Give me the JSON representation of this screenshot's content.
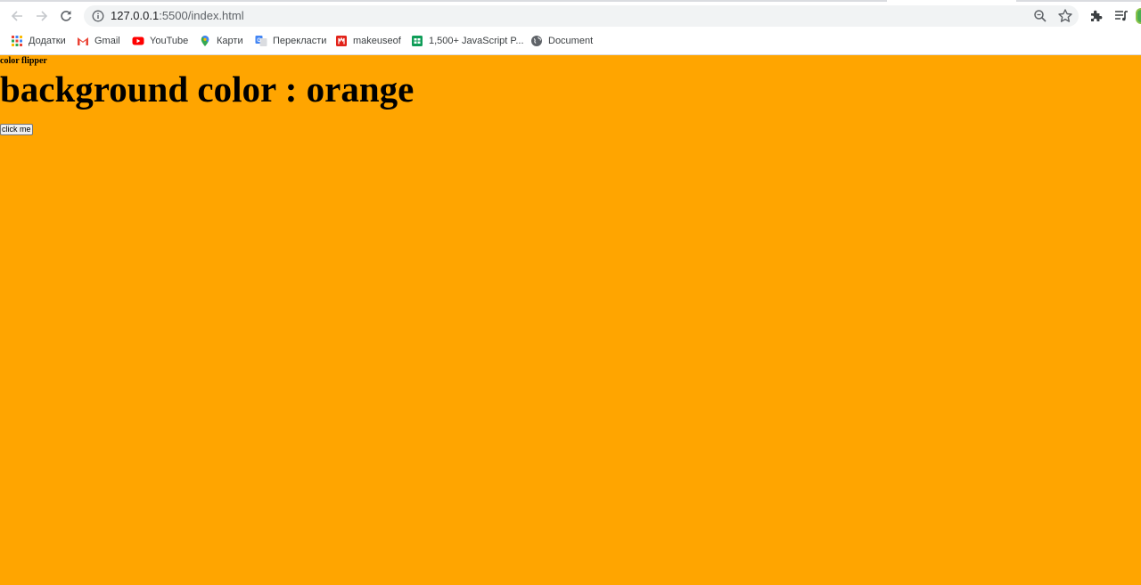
{
  "browser": {
    "url_host": "127.0.0.1",
    "url_rest": ":5500/index.html",
    "bookmarks": [
      {
        "label": "Додатки",
        "icon": "apps-grid-icon"
      },
      {
        "label": "Gmail",
        "icon": "gmail-icon"
      },
      {
        "label": "YouTube",
        "icon": "youtube-icon"
      },
      {
        "label": "Карти",
        "icon": "maps-pin-icon"
      },
      {
        "label": "Перекласти",
        "icon": "translate-icon"
      },
      {
        "label": "makeuseof",
        "icon": "makeuseof-icon"
      },
      {
        "label": "1,500+ JavaScript P...",
        "icon": "sheet-icon"
      },
      {
        "label": "Document",
        "icon": "globe-icon"
      }
    ]
  },
  "page": {
    "background_color": "#ffa500",
    "small_title": "color flipper",
    "heading": "background color : orange",
    "button_label": "click me"
  }
}
